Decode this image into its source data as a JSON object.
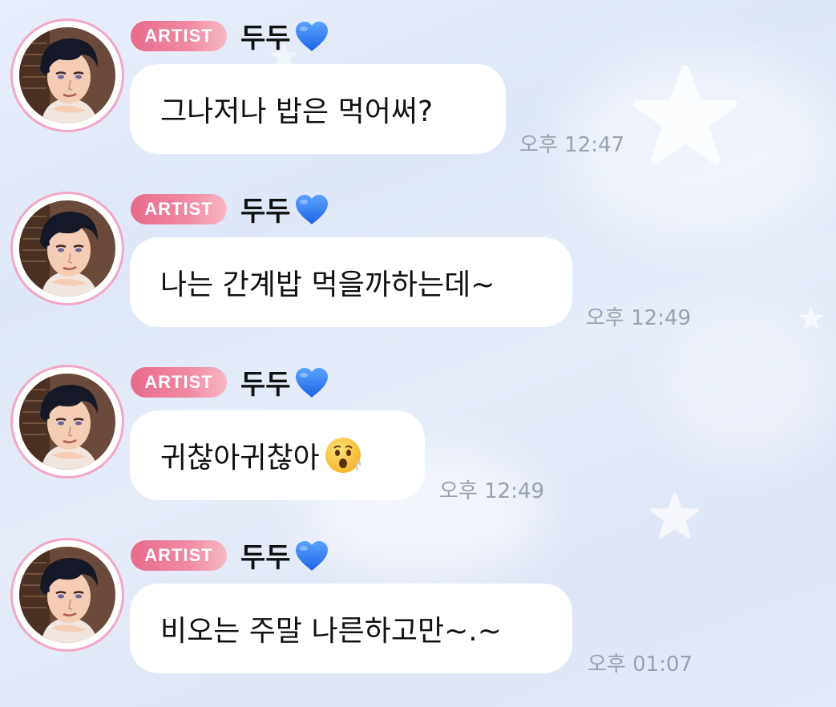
{
  "messages": [
    {
      "badge": "ARTIST",
      "sender": "두두",
      "text": "그나저나 밥은 먹어써?",
      "time": "오후 12:47"
    },
    {
      "badge": "ARTIST",
      "sender": "두두",
      "text": "나는 간계밥 먹을까하는데~",
      "time": "오후 12:49"
    },
    {
      "badge": "ARTIST",
      "sender": "두두",
      "text": "귀찮아귀찮아",
      "emoji": "hushed-face-emoji",
      "time": "오후 12:49"
    },
    {
      "badge": "ARTIST",
      "sender": "두두",
      "text": "비오는 주말 나른하고만~.~",
      "time": "오후 01:07"
    }
  ],
  "icons": {
    "avatar": "artist-avatar-portrait",
    "heart": "blue-heart-icon"
  },
  "colors": {
    "badge": "#e96a8c",
    "avatar_ring": "#f3a6c6",
    "heart": "#2f7cf6",
    "time": "#9aa1ad",
    "bubble": "#ffffff"
  }
}
